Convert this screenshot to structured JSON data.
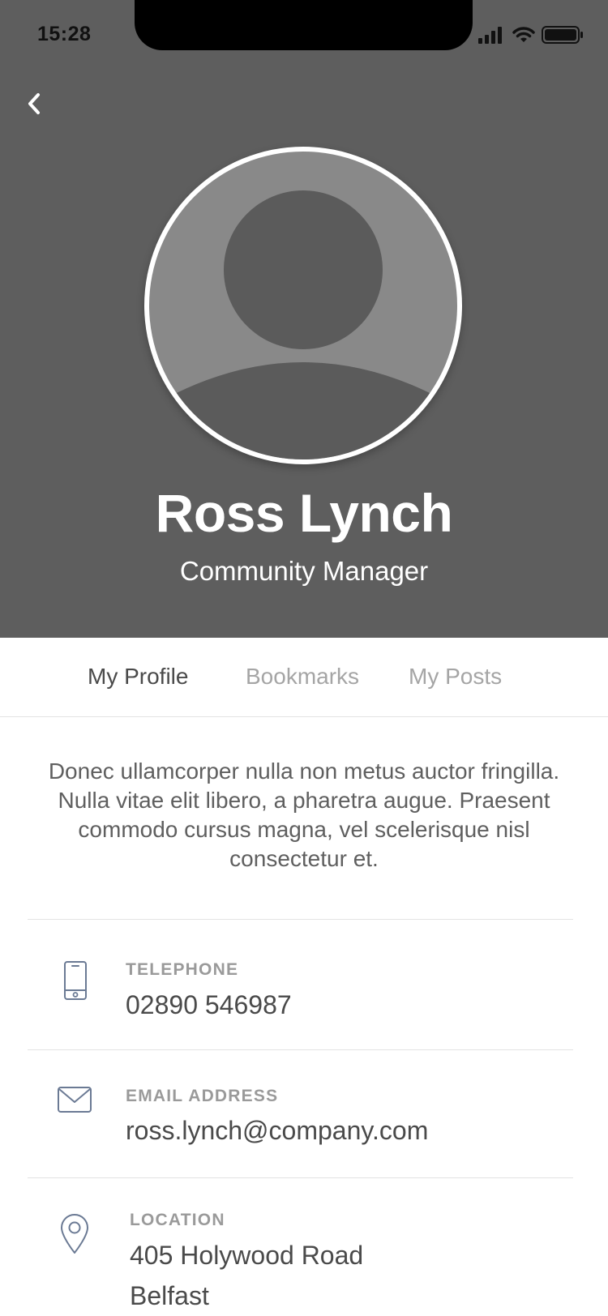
{
  "status_bar": {
    "time": "15:28"
  },
  "profile": {
    "name": "Ross Lynch",
    "role": "Community Manager",
    "bio": "Donec ullamcorper nulla non metus auctor fringilla. Nulla vitae elit libero, a pharetra augue. Praesent commodo cursus magna, vel scelerisque nisl consectetur et."
  },
  "tabs": [
    {
      "label": "My Profile",
      "active": true
    },
    {
      "label": "Bookmarks",
      "active": false
    },
    {
      "label": "My Posts",
      "active": false
    }
  ],
  "contact": {
    "telephone": {
      "label": "TELEPHONE",
      "value": "02890 546987",
      "icon": "phone-icon"
    },
    "email": {
      "label": "EMAIL ADDRESS",
      "value": "ross.lynch@company.com",
      "icon": "mail-icon"
    },
    "location": {
      "label": "LOCATION",
      "line1": "405 Holywood Road",
      "line2": "Belfast",
      "icon": "location-pin-icon"
    }
  },
  "icons": {
    "back": "chevron-left-icon",
    "signal": "cellular-signal-icon",
    "wifi": "wifi-icon",
    "battery": "battery-icon"
  },
  "colors": {
    "header_bg": "#5e5e5e",
    "avatar_bg": "#898989",
    "avatar_figure": "#5b5b5b",
    "tab_active": "#4a4a4a",
    "tab_inactive": "#a5a5a5",
    "icon_stroke": "#6b7a94"
  }
}
